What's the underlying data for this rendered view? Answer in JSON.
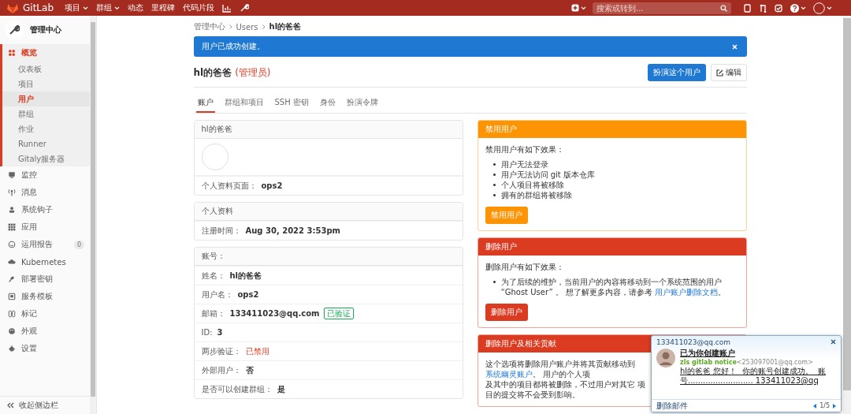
{
  "topbar": {
    "brand": "GitLab",
    "nav": [
      {
        "label": "项目",
        "dropdown": true
      },
      {
        "label": "群组",
        "dropdown": true
      },
      {
        "label": "动态",
        "dropdown": false
      },
      {
        "label": "里程碑",
        "dropdown": false
      },
      {
        "label": "代码片段",
        "dropdown": false
      }
    ],
    "search": {
      "placeholder": "搜索或转到..."
    }
  },
  "sidebar": {
    "title": "管理中心",
    "items": [
      {
        "label": "概览",
        "selected": true,
        "children": [
          {
            "label": "仪表板",
            "selected": false
          },
          {
            "label": "项目",
            "selected": false
          },
          {
            "label": "用户",
            "selected": true
          },
          {
            "label": "群组",
            "selected": false
          },
          {
            "label": "作业",
            "selected": false
          },
          {
            "label": "Runner",
            "selected": false
          },
          {
            "label": "Gitaly服务器",
            "selected": false
          }
        ]
      },
      {
        "label": "监控",
        "selected": false
      },
      {
        "label": "消息",
        "selected": false
      },
      {
        "label": "系统钩子",
        "selected": false
      },
      {
        "label": "应用",
        "selected": false
      },
      {
        "label": "运用报告",
        "selected": false,
        "badge": "0"
      },
      {
        "label": "Kubernetes",
        "selected": false
      },
      {
        "label": "部署密钥",
        "selected": false
      },
      {
        "label": "服务模板",
        "selected": false
      },
      {
        "label": "标记",
        "selected": false
      },
      {
        "label": "外观",
        "selected": false
      },
      {
        "label": "设置",
        "selected": false
      }
    ],
    "collapse": "收起侧边栏"
  },
  "main": {
    "breadcrumb": [
      "管理中心",
      "Users",
      "hl的爸爸"
    ],
    "alert": "用户已成功创建。",
    "heading": {
      "name": "hl的爸爸",
      "role": "(管理员)"
    },
    "buttons": [
      {
        "kind": "primary",
        "label": "扮演这个用户"
      },
      {
        "kind": "edit",
        "label": "编辑"
      }
    ],
    "tabs": [
      {
        "label": "账户",
        "selected": true
      },
      {
        "label": "群组和项目",
        "selected": false
      },
      {
        "label": "SSH 密钥",
        "selected": false
      },
      {
        "label": "身份",
        "selected": false
      },
      {
        "label": "扮演令牌",
        "selected": false
      }
    ],
    "info_cards": [
      {
        "title": "hl的爸爸",
        "avatar": true,
        "rows": [
          {
            "label": "个人资料页面：",
            "value": "ops2",
            "kind": "plain"
          }
        ]
      },
      {
        "title": "个人资料",
        "avatar": false,
        "rows": [
          {
            "label": "注册时间：",
            "value": "Aug 30, 2022 3:53pm",
            "kind": "plain"
          }
        ]
      },
      {
        "title": "账号：",
        "avatar": false,
        "rows": [
          {
            "label": "姓名：",
            "value": "hl的爸爸",
            "kind": "plain"
          },
          {
            "label": "用户名：",
            "value": "ops2",
            "kind": "plain"
          },
          {
            "label": "邮箱：",
            "value": "133411023@qq.com",
            "kind": "plain",
            "badge": "已验证"
          },
          {
            "label": "ID:",
            "value": "3",
            "kind": "plain"
          },
          {
            "label": "两步验证：",
            "value": "已禁用",
            "kind": "danger"
          },
          {
            "label": "外部用户：",
            "value": "否",
            "kind": "plain"
          },
          {
            "label": "是否可以创建群组：",
            "value": "是",
            "kind": "plain"
          }
        ]
      }
    ],
    "action_cards": [
      {
        "kind": "warning",
        "title": "禁用用户",
        "intro": "禁用用户有如下效果：",
        "bullets": [
          {
            "text": "用户无法登录"
          },
          {
            "text": "用户无法访问 git 版本仓库"
          },
          {
            "text": "个人项目将被移除"
          },
          {
            "text": "拥有的群组将被移除"
          }
        ],
        "button": "禁用用户"
      },
      {
        "kind": "danger",
        "title": "删除用户",
        "intro": "删除用户有如下效果：",
        "bullets": [
          {
            "text": "为了后续的维护，当前用户的内容将移动到一个系统范围的用户 “Ghost User” 。 想了解更多内容，请参考 ",
            "link": "用户账户删除文档",
            "after": "。"
          }
        ],
        "button": "删除用户"
      },
      {
        "kind": "danger",
        "title": "删除用户及相关贡献",
        "paragraphs": [
          {
            "text": "这个选项将删除用户账户并将其贡献移动到 ",
            "link": "系统幽灵账户",
            "after": "。 用户的个人项"
          },
          {
            "text": "及其中的项目都将被删除，不过用户对其它 项目的提交将不会受到影响。"
          }
        ]
      }
    ]
  },
  "notification": {
    "account": "133411023@qq.com",
    "subject": "已为你创建账户",
    "sender": "zls gitlab notice",
    "sender_email": "<253097001@qq.com>",
    "preview": [
      "hl的爸爸 您好！  你的账号创建成功。  账",
      "号.......................... 133411023@qq"
    ],
    "delete": "删除邮件",
    "pager": "1/5"
  }
}
